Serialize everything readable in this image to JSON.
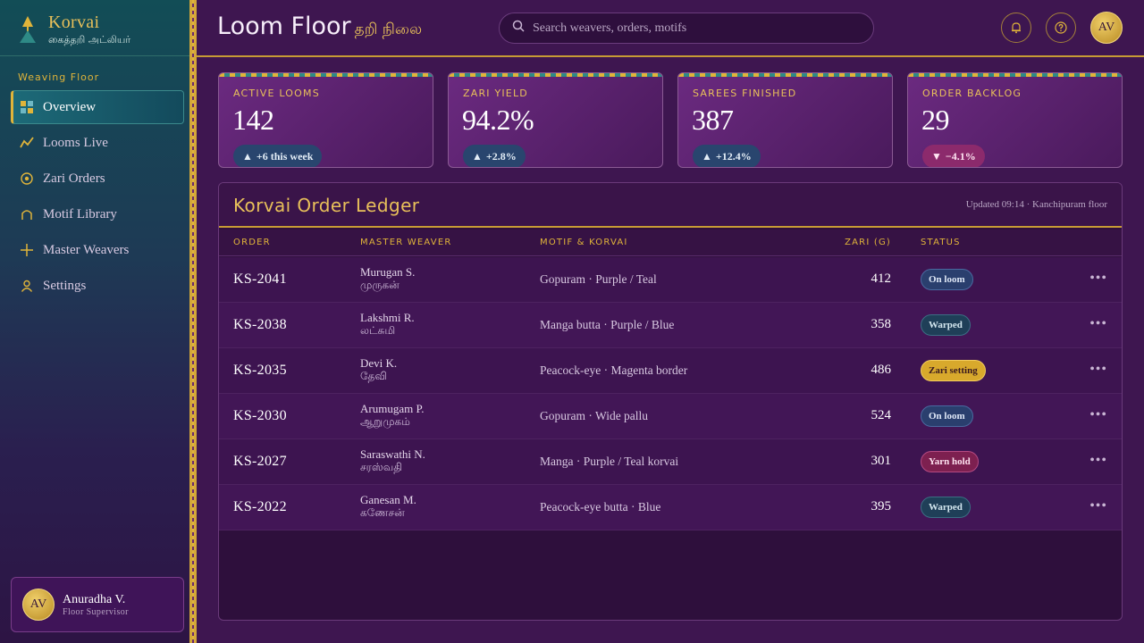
{
  "brand": {
    "name": "Korvai",
    "subtitle": "கைத்தறி அட்லியர்"
  },
  "sidebar": {
    "section_label": "Weaving Floor",
    "items": [
      {
        "label": "Overview",
        "icon": "grid-icon",
        "active": true
      },
      {
        "label": "Looms Live",
        "icon": "trend-line-icon",
        "active": false
      },
      {
        "label": "Zari Orders",
        "icon": "target-icon",
        "active": false
      },
      {
        "label": "Motif Library",
        "icon": "arch-icon",
        "active": false
      },
      {
        "label": "Master Weavers",
        "icon": "plus-icon",
        "active": false
      },
      {
        "label": "Settings",
        "icon": "user-icon",
        "active": false
      }
    ],
    "user": {
      "initials": "AV",
      "name": "Anuradha V.",
      "role": "Floor Supervisor"
    }
  },
  "header": {
    "title": "Loom Floor",
    "title_tamil": "தறி நிலை",
    "search_placeholder": "Search weavers, orders, motifs",
    "avatar_initials": "AV"
  },
  "kpis": [
    {
      "label": "ACTIVE LOOMS",
      "value": "142",
      "delta": "+6 this week",
      "direction": "up"
    },
    {
      "label": "ZARI YIELD",
      "value": "94.2%",
      "delta": "+2.8%",
      "direction": "up"
    },
    {
      "label": "SAREES FINISHED",
      "value": "387",
      "delta": "+12.4%",
      "direction": "up"
    },
    {
      "label": "ORDER BACKLOG",
      "value": "29",
      "delta": "−4.1%",
      "direction": "down"
    }
  ],
  "ledger": {
    "title": "Korvai Order Ledger",
    "updated": "Updated 09:14 · Kanchipuram floor",
    "columns": {
      "order": "ORDER",
      "weaver": "MASTER WEAVER",
      "motif": "MOTIF & KORVAI",
      "zari": "ZARI (G)",
      "status": "STATUS"
    },
    "rows": [
      {
        "order": "KS-2041",
        "weaver": "Murugan S.",
        "weaver_ta": "முருகன்",
        "motif": "Gopuram · Purple / Teal",
        "zari": "412",
        "status": "On loom",
        "status_kind": "onloom"
      },
      {
        "order": "KS-2038",
        "weaver": "Lakshmi R.",
        "weaver_ta": "லட்சுமி",
        "motif": "Manga butta · Purple / Blue",
        "zari": "358",
        "status": "Warped",
        "status_kind": "warped"
      },
      {
        "order": "KS-2035",
        "weaver": "Devi K.",
        "weaver_ta": "தேவி",
        "motif": "Peacock-eye · Magenta border",
        "zari": "486",
        "status": "Zari setting",
        "status_kind": "zari"
      },
      {
        "order": "KS-2030",
        "weaver": "Arumugam P.",
        "weaver_ta": "ஆறுமுகம்",
        "motif": "Gopuram · Wide pallu",
        "zari": "524",
        "status": "On loom",
        "status_kind": "onloom"
      },
      {
        "order": "KS-2027",
        "weaver": "Saraswathi N.",
        "weaver_ta": "சரஸ்வதி",
        "motif": "Manga · Purple / Teal korvai",
        "zari": "301",
        "status": "Yarn hold",
        "status_kind": "yarn"
      },
      {
        "order": "KS-2022",
        "weaver": "Ganesan M.",
        "weaver_ta": "கணேசன்",
        "motif": "Peacock-eye butta · Blue",
        "zari": "395",
        "status": "Warped",
        "status_kind": "warped"
      }
    ]
  },
  "colors": {
    "gold": "#e0b43a",
    "teal": "#124d56",
    "plum": "#3e1650"
  }
}
